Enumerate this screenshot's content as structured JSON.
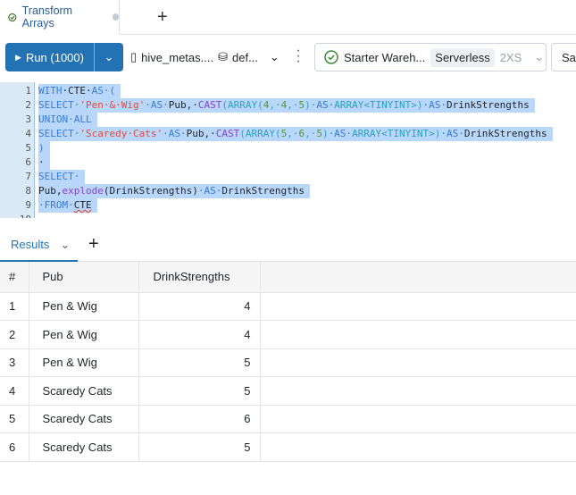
{
  "tab": {
    "title": "Transform Arrays",
    "new_tab": "+"
  },
  "toolbar": {
    "run_label": "Run (1000)",
    "catalog": "hive_metas....",
    "schema": "def...",
    "warehouse": "Starter Wareh...",
    "type": "Serverless",
    "size": "2XS",
    "save": "Save"
  },
  "editor": {
    "lines": [
      [
        [
          "kw",
          "WITH"
        ],
        [
          "",
          "·CTE·"
        ],
        [
          "kw",
          "AS"
        ],
        [
          "kw",
          "·("
        ]
      ],
      [
        [
          "kw",
          "SELECT·"
        ],
        [
          "str",
          "'Pen·&·Wig'"
        ],
        [
          "kw",
          "·AS·"
        ],
        [
          "",
          "Pub,·"
        ],
        [
          "fn",
          "CAST"
        ],
        [
          "ty",
          "(ARRAY("
        ],
        [
          "num",
          "4"
        ],
        [
          "ty",
          ",·"
        ],
        [
          "num",
          "4"
        ],
        [
          "ty",
          ",·"
        ],
        [
          "num",
          "5"
        ],
        [
          "ty",
          ")"
        ],
        [
          "kw",
          "·AS·"
        ],
        [
          "ty",
          "ARRAY<TINYINT>)"
        ],
        [
          "kw",
          "·AS·"
        ],
        [
          "",
          "DrinkStrengths"
        ]
      ],
      [
        [
          "kw",
          "UNION·ALL"
        ]
      ],
      [
        [
          "kw",
          "SELECT·"
        ],
        [
          "str",
          "'Scaredy·Cats'"
        ],
        [
          "kw",
          "·AS·"
        ],
        [
          "",
          "Pub,·"
        ],
        [
          "fn",
          "CAST"
        ],
        [
          "ty",
          "(ARRAY("
        ],
        [
          "num",
          "5"
        ],
        [
          "ty",
          ",·"
        ],
        [
          "num",
          "6"
        ],
        [
          "ty",
          ",·"
        ],
        [
          "num",
          "5"
        ],
        [
          "ty",
          ")"
        ],
        [
          "kw",
          "·AS·"
        ],
        [
          "ty",
          "ARRAY<TINYINT>)"
        ],
        [
          "kw",
          "·AS·"
        ],
        [
          "",
          "DrinkStrengths"
        ]
      ],
      [
        [
          "kw",
          ")"
        ]
      ],
      [
        [
          "",
          "·"
        ]
      ],
      [
        [
          "kw",
          "SELECT·"
        ]
      ],
      [
        [
          "",
          "Pub,"
        ],
        [
          "fn",
          "explode"
        ],
        [
          "",
          "(DrinkStrengths)"
        ],
        [
          "kw",
          "·AS·"
        ],
        [
          "",
          "DrinkStrengths"
        ]
      ],
      [
        [
          "kw",
          "·FROM·"
        ],
        [
          "squig",
          "CTE"
        ]
      ],
      [
        [
          "",
          ""
        ]
      ]
    ]
  },
  "results": {
    "tab_label": "Results",
    "add": "+",
    "columns": [
      "#",
      "Pub",
      "DrinkStrengths"
    ],
    "rows": [
      [
        "1",
        "Pen & Wig",
        "4"
      ],
      [
        "2",
        "Pen & Wig",
        "4"
      ],
      [
        "3",
        "Pen & Wig",
        "5"
      ],
      [
        "4",
        "Scaredy Cats",
        "5"
      ],
      [
        "5",
        "Scaredy Cats",
        "6"
      ],
      [
        "6",
        "Scaredy Cats",
        "5"
      ]
    ]
  }
}
